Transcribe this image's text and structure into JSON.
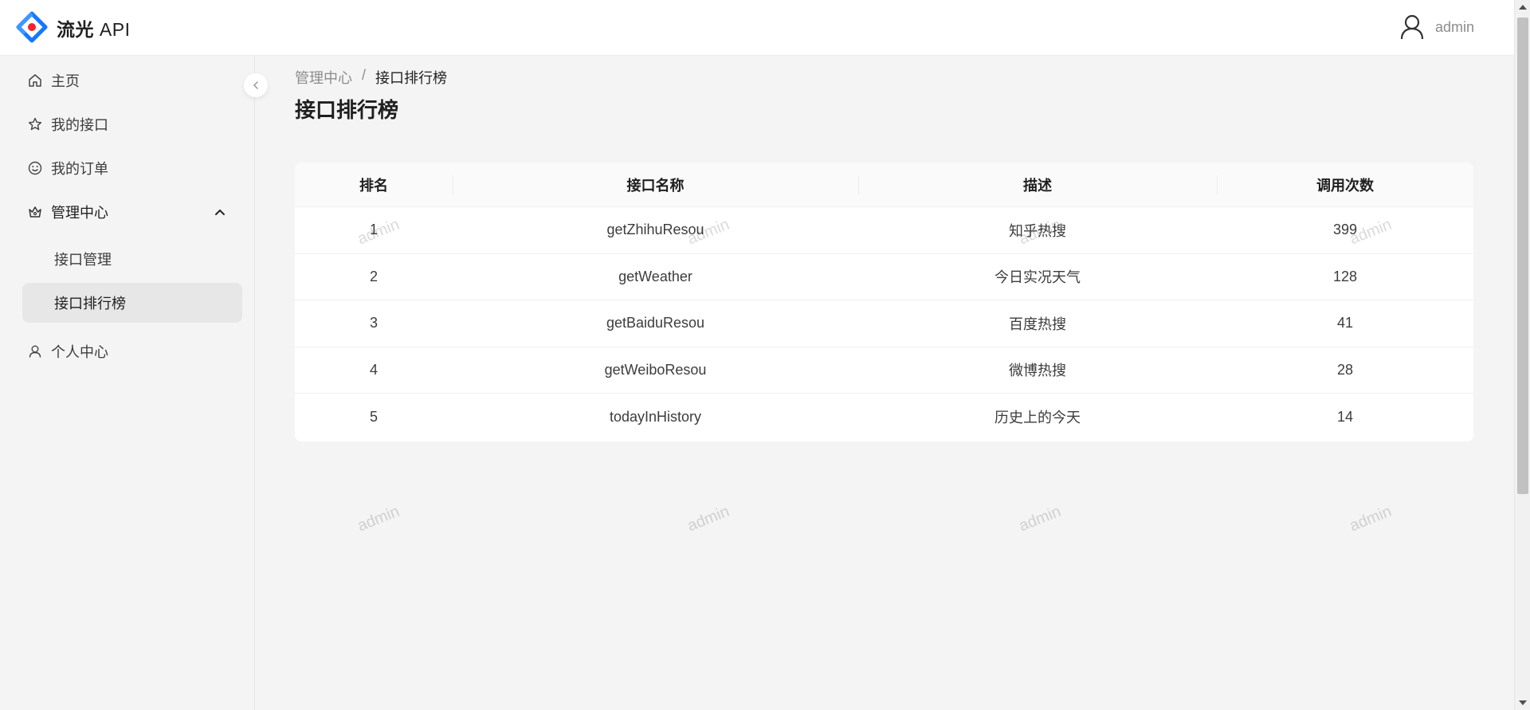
{
  "app": {
    "name_cn": "流光",
    "name_api": "API"
  },
  "header": {
    "user_name": "admin"
  },
  "sidebar": {
    "items": [
      {
        "label": "主页",
        "icon": "home-icon"
      },
      {
        "label": "我的接口",
        "icon": "star-icon"
      },
      {
        "label": "我的订单",
        "icon": "smile-icon"
      },
      {
        "label": "管理中心",
        "icon": "crown-icon",
        "expanded": true
      },
      {
        "label": "个人中心",
        "icon": "user-icon"
      }
    ],
    "sub_items": [
      {
        "label": "接口管理"
      },
      {
        "label": "接口排行榜",
        "active": true
      }
    ]
  },
  "breadcrumb": {
    "parent": "管理中心",
    "separator": "/",
    "current": "接口排行榜"
  },
  "page_title": "接口排行榜",
  "table": {
    "columns": [
      "排名",
      "接口名称",
      "描述",
      "调用次数"
    ],
    "rows": [
      [
        "1",
        "getZhihuResou",
        "知乎热搜",
        "399"
      ],
      [
        "2",
        "getWeather",
        "今日实况天气",
        "128"
      ],
      [
        "3",
        "getBaiduResou",
        "百度热搜",
        "41"
      ],
      [
        "4",
        "getWeiboResou",
        "微博热搜",
        "28"
      ],
      [
        "5",
        "todayInHistory",
        "历史上的今天",
        "14"
      ]
    ]
  },
  "watermark": "admin",
  "colors": {
    "brand_blue": "#1677ff",
    "brand_red": "#f5222d",
    "active_bg": "#e7e7e7"
  }
}
